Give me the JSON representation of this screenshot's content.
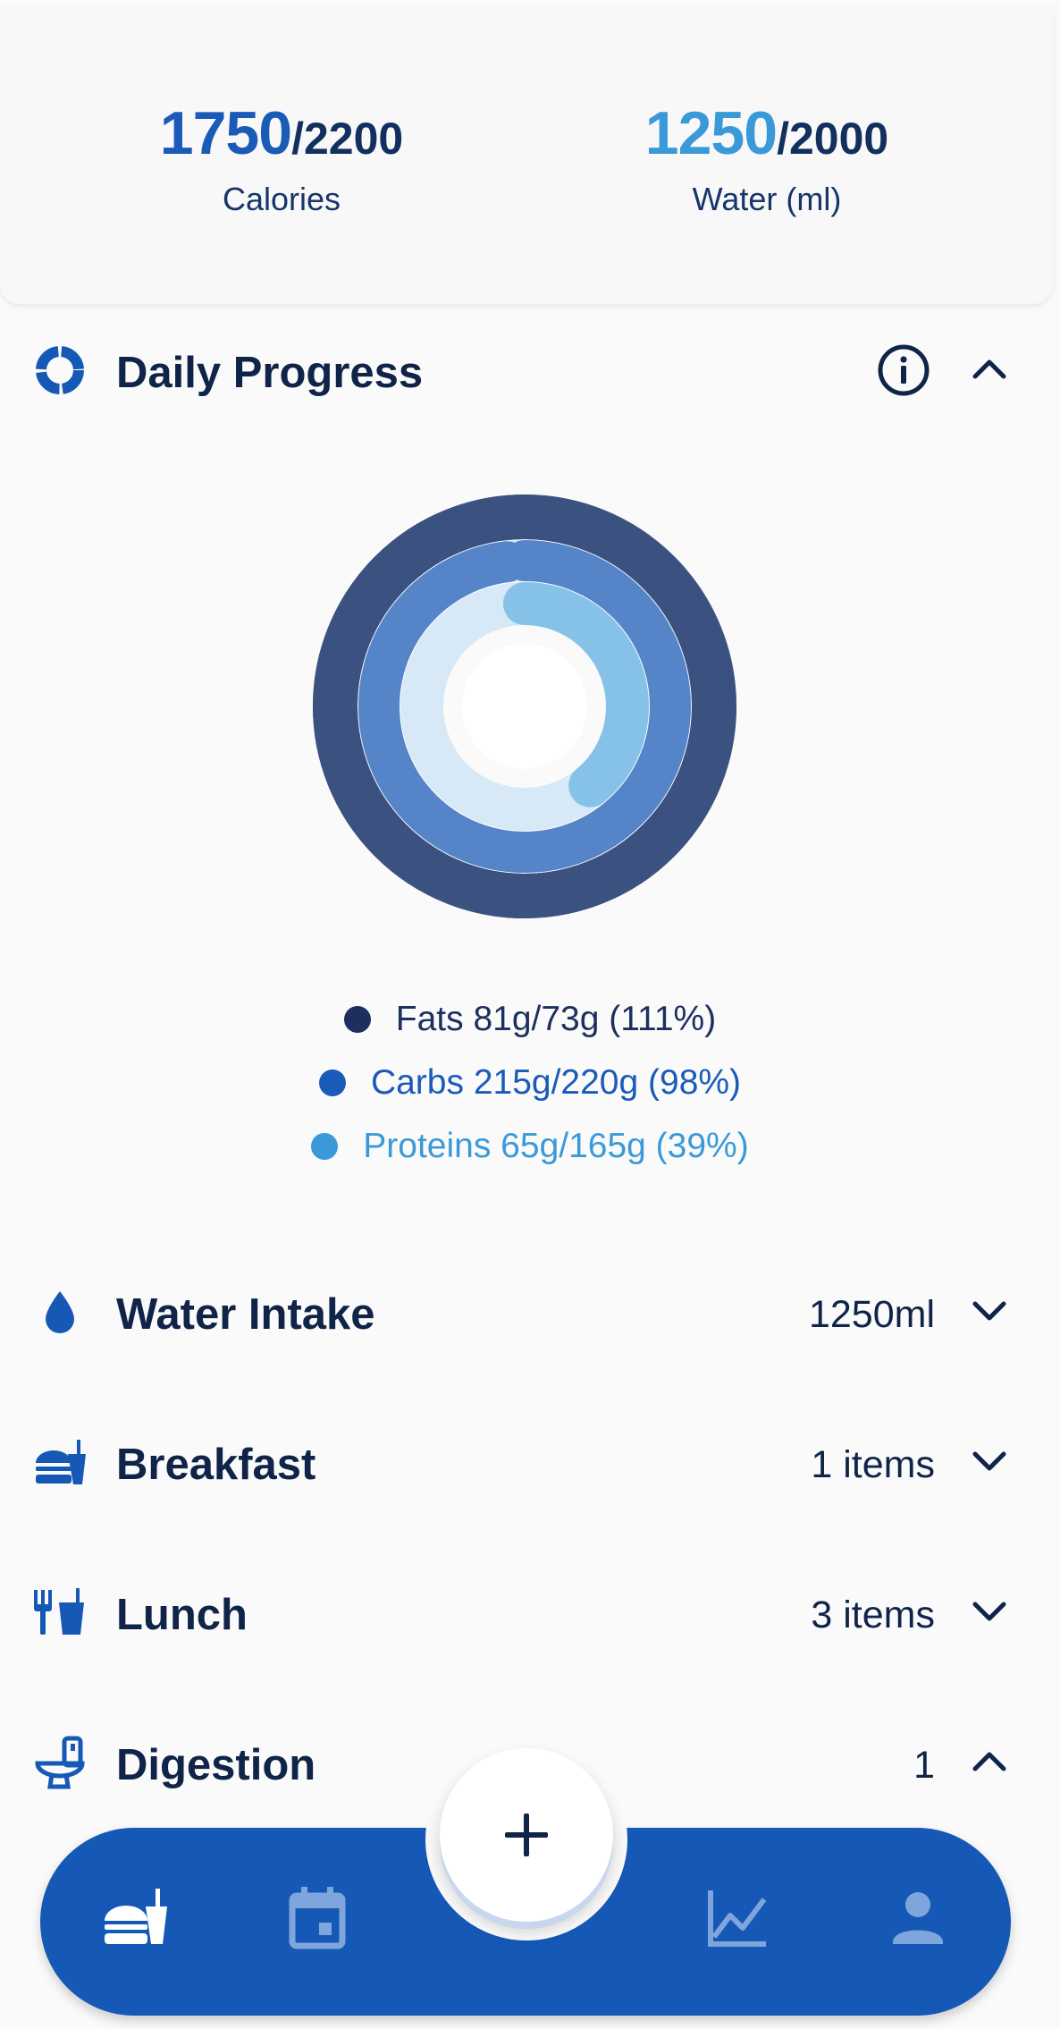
{
  "summary": {
    "calories": {
      "value": "1750",
      "total": "/2200",
      "label": "Calories"
    },
    "water": {
      "value": "1250",
      "total": "/2000",
      "label": "Water (ml)"
    }
  },
  "daily_progress": {
    "title": "Daily Progress",
    "icons": {
      "section": "donut-chart-icon",
      "info": "info-icon",
      "toggle": "chevron-up-icon"
    },
    "macros": [
      {
        "label": "Fats 81g/73g (111%)",
        "name": "Fats",
        "consumed_g": 81,
        "goal_g": 73,
        "percent": 111,
        "color": "#1c2f5e",
        "ring_color": "#3b5180"
      },
      {
        "label": "Carbs 215g/220g (98%)",
        "name": "Carbs",
        "consumed_g": 215,
        "goal_g": 220,
        "percent": 98,
        "color": "#1a5bb8",
        "ring_color": "#5585c8"
      },
      {
        "label": "Proteins 65g/165g (39%)",
        "name": "Proteins",
        "consumed_g": 65,
        "goal_g": 165,
        "percent": 39,
        "color": "#3a9ad9",
        "ring_color": "#86c2e8"
      }
    ]
  },
  "sections": [
    {
      "id": "water",
      "title": "Water Intake",
      "meta": "1250ml",
      "icon": "water-drop-icon",
      "state": "collapsed"
    },
    {
      "id": "breakfast",
      "title": "Breakfast",
      "meta": "1 items",
      "icon": "fastfood-icon",
      "state": "collapsed"
    },
    {
      "id": "lunch",
      "title": "Lunch",
      "meta": "3 items",
      "icon": "restaurant-icon",
      "state": "collapsed"
    },
    {
      "id": "digestion",
      "title": "Digestion",
      "meta": "1",
      "icon": "toilet-icon",
      "state": "expanded"
    }
  ],
  "fab": {
    "icon": "plus-icon"
  },
  "nav": [
    {
      "id": "food",
      "icon": "fastfood-icon",
      "active": true
    },
    {
      "id": "calendar",
      "icon": "calendar-icon",
      "active": false
    },
    {
      "id": "stats",
      "icon": "chart-line-icon",
      "active": false
    },
    {
      "id": "profile",
      "icon": "person-icon",
      "active": false
    }
  ],
  "colors": {
    "primary": "#1558b5",
    "text": "#0f2448",
    "accent_light": "#3a9ad9"
  }
}
